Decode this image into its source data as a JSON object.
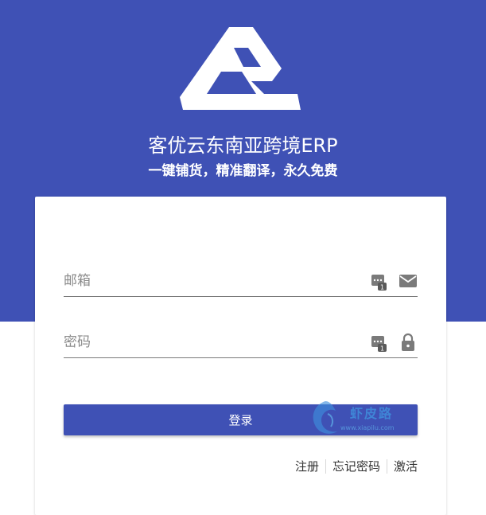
{
  "header": {
    "title": "客优云东南亚跨境ERP",
    "subtitle": "一键铺货，精准翻译，永久免费",
    "logo_icon": "brand-logo-icon"
  },
  "form": {
    "email": {
      "placeholder": "邮箱",
      "value": "",
      "key_icon": "password-manager-icon",
      "icon": "envelope-icon"
    },
    "password": {
      "placeholder": "密码",
      "value": "",
      "key_icon": "password-manager-icon",
      "icon": "lock-icon"
    },
    "login_label": "登录"
  },
  "links": {
    "register": "注册",
    "forgot_password": "忘记密码",
    "activate": "激活"
  },
  "watermark": {
    "text": "虾皮路",
    "sub": "www.xiapilu.com"
  },
  "colors": {
    "primary": "#3f51b5",
    "background": "#ffffff",
    "text": "#333333"
  }
}
